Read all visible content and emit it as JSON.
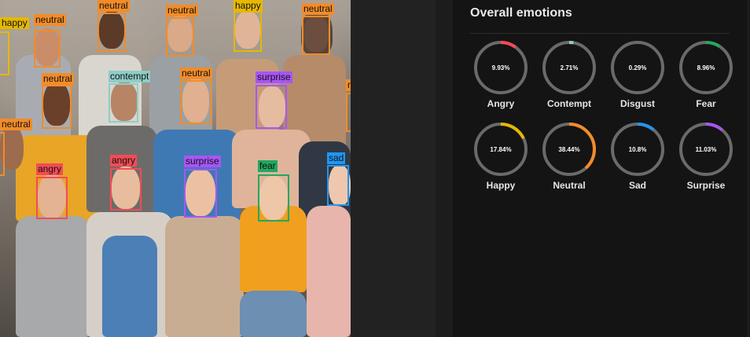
{
  "photo": {
    "detections": [
      {
        "label": "happy",
        "color": "#e6b800"
      },
      {
        "label": "neutral",
        "color": "#f28c28"
      },
      {
        "label": "neutral",
        "color": "#f28c28"
      },
      {
        "label": "neutral",
        "color": "#f28c28"
      },
      {
        "label": "happy",
        "color": "#e6b800"
      },
      {
        "label": "neutral",
        "color": "#f28c28"
      },
      {
        "label": "neutral",
        "color": "#f28c28"
      },
      {
        "label": "contempt",
        "color": "#8ecdc7"
      },
      {
        "label": "neutral",
        "color": "#f28c28"
      },
      {
        "label": "surprise",
        "color": "#a855f7"
      },
      {
        "label": "neutral",
        "color": "#f28c28"
      },
      {
        "label": "neutral",
        "color": "#f28c28"
      },
      {
        "label": "angry",
        "color": "#f44b55"
      },
      {
        "label": "angry",
        "color": "#f44b55"
      },
      {
        "label": "surprise",
        "color": "#a855f7"
      },
      {
        "label": "fear",
        "color": "#22a861"
      },
      {
        "label": "sad",
        "color": "#2196f3"
      }
    ]
  },
  "panel": {
    "title": "Overall emotions",
    "emotions": [
      {
        "name": "Angry",
        "percent": 9.93,
        "percent_text": "9.93%",
        "color": "#f44b55"
      },
      {
        "name": "Contempt",
        "percent": 2.71,
        "percent_text": "2.71%",
        "color": "#8ecdc7"
      },
      {
        "name": "Disgust",
        "percent": 0.29,
        "percent_text": "0.29%",
        "color": "#6d6d6d"
      },
      {
        "name": "Fear",
        "percent": 8.96,
        "percent_text": "8.96%",
        "color": "#22a861"
      },
      {
        "name": "Happy",
        "percent": 17.84,
        "percent_text": "17.84%",
        "color": "#e6b800"
      },
      {
        "name": "Neutral",
        "percent": 38.44,
        "percent_text": "38.44%",
        "color": "#f28c28"
      },
      {
        "name": "Sad",
        "percent": 10.8,
        "percent_text": "10.8%",
        "color": "#2196f3"
      },
      {
        "name": "Surprise",
        "percent": 11.03,
        "percent_text": "11.03%",
        "color": "#a855f7"
      }
    ]
  }
}
